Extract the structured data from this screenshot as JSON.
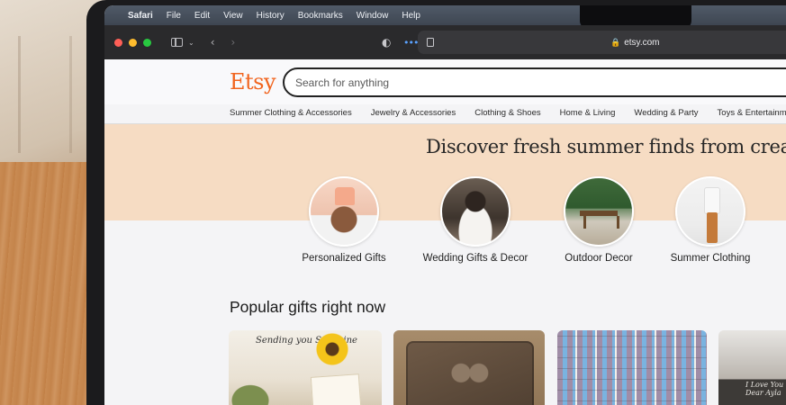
{
  "menubar": {
    "apple_icon": "",
    "items": [
      "Safari",
      "File",
      "Edit",
      "View",
      "History",
      "Bookmarks",
      "Window",
      "Help"
    ]
  },
  "toolbar": {
    "url": "etsy.com"
  },
  "etsy": {
    "logo": "Etsy",
    "search_placeholder": "Search for anything",
    "nav": [
      "Summer Clothing & Accessories",
      "Jewelry & Accessories",
      "Clothing & Shoes",
      "Home & Living",
      "Wedding & Party",
      "Toys & Entertainment"
    ],
    "hero_title": "Discover fresh summer finds from creative s",
    "categories": [
      "Personalized Gifts",
      "Wedding Gifts & Decor",
      "Outdoor Decor",
      "Summer Clothing"
    ],
    "section_title": "Popular gifts right now",
    "product_texts": {
      "card1": "Sending you Sunshine",
      "card4": "I Love You Dear Ayla"
    }
  },
  "colors": {
    "etsy_orange": "#f1641e",
    "hero_bg": "#f6dcc3",
    "traffic_red": "#fe5f57",
    "traffic_yellow": "#febc2e",
    "traffic_green": "#28c840"
  }
}
